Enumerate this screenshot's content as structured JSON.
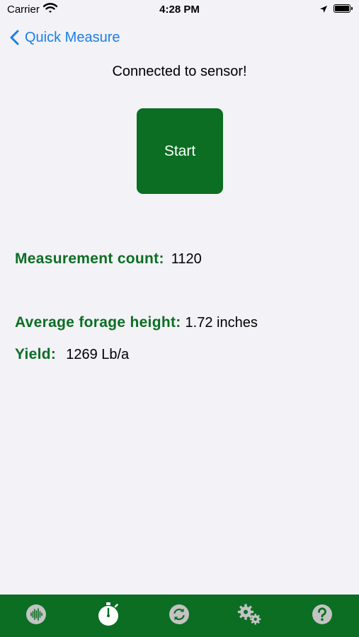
{
  "status_bar": {
    "carrier": "Carrier",
    "time": "4:28 PM"
  },
  "nav": {
    "back_label": "Quick Measure"
  },
  "status": {
    "message": "Connected to sensor!"
  },
  "actions": {
    "start_label": "Start"
  },
  "metrics": [
    {
      "label": "Measurement count:",
      "value": "1120"
    },
    {
      "label": "Average forage height:",
      "value": "1.72 inches"
    },
    {
      "label": "Yield:",
      "value": "1269 Lb/a"
    }
  ],
  "tab_bar": {
    "tabs": [
      {
        "icon": "sound-wave-icon",
        "active": false
      },
      {
        "icon": "stopwatch-icon",
        "active": true
      },
      {
        "icon": "sync-icon",
        "active": false
      },
      {
        "icon": "gears-icon",
        "active": false
      },
      {
        "icon": "help-icon",
        "active": false
      }
    ]
  },
  "colors": {
    "brand_green": "#0b6e22",
    "link_blue": "#1a7ee8",
    "background": "#f2f2f7",
    "inactive_icon": "#c3c3c3"
  }
}
